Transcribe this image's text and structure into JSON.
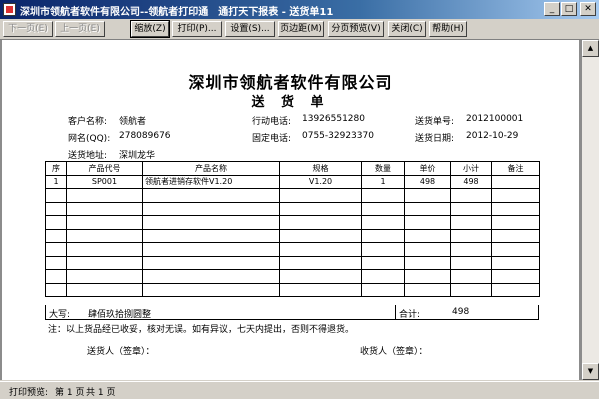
{
  "window": {
    "title": "深圳市领航者软件有限公司--领航者打印通　通打天下报表 - 送货单11"
  },
  "toolbar": {
    "prev_page": "下一页(E)",
    "prev_page2": "上一页(E)",
    "zoom": "缩放(Z)",
    "print": "打印(P)...",
    "settings": "设置(S)...",
    "margins": "页边距(M)",
    "page_preview": "分页预览(V)",
    "close": "关闭(C)",
    "help": "帮助(H)"
  },
  "document": {
    "company": "深圳市领航者软件有限公司",
    "form_title": "送 货 单",
    "fields": {
      "customer_label": "客户名称:",
      "customer_value": "领航者",
      "mobile_label": "行动电话:",
      "mobile_value": "13926551280",
      "order_no_label": "送货单号:",
      "order_no_value": "2012100001",
      "qq_label": "网名(QQ):",
      "qq_value": "278089676",
      "phone_label": "固定电话:",
      "phone_value": "0755-32923370",
      "date_label": "送货日期:",
      "date_value": "2012-10-29",
      "address_label": "送货地址:",
      "address_value": "深圳龙华"
    },
    "table": {
      "headers": [
        "序",
        "产品代号",
        "产品名称",
        "规格",
        "数量",
        "单价",
        "小计",
        "备注"
      ],
      "rows": [
        [
          "1",
          "SP001",
          "领航者进销存软件V1.20",
          "V1.20",
          "1",
          "498",
          "498",
          ""
        ]
      ],
      "empty_rows": 8
    },
    "totals": {
      "daxie_label": "大写:",
      "daxie_value": "肆佰玖拾捌圆整",
      "sum_label": "合计:",
      "sum_value": "498"
    },
    "note": "注：以上货品经已收妥，核对无误。如有异议，七天内提出，否则不得退货。",
    "sender_label": "送货人（签章）：",
    "receiver_label": "收货人（签章）："
  },
  "status": {
    "mode": "打印预览:",
    "page_text": "第 1 页",
    "total_text": "共 1 页"
  }
}
